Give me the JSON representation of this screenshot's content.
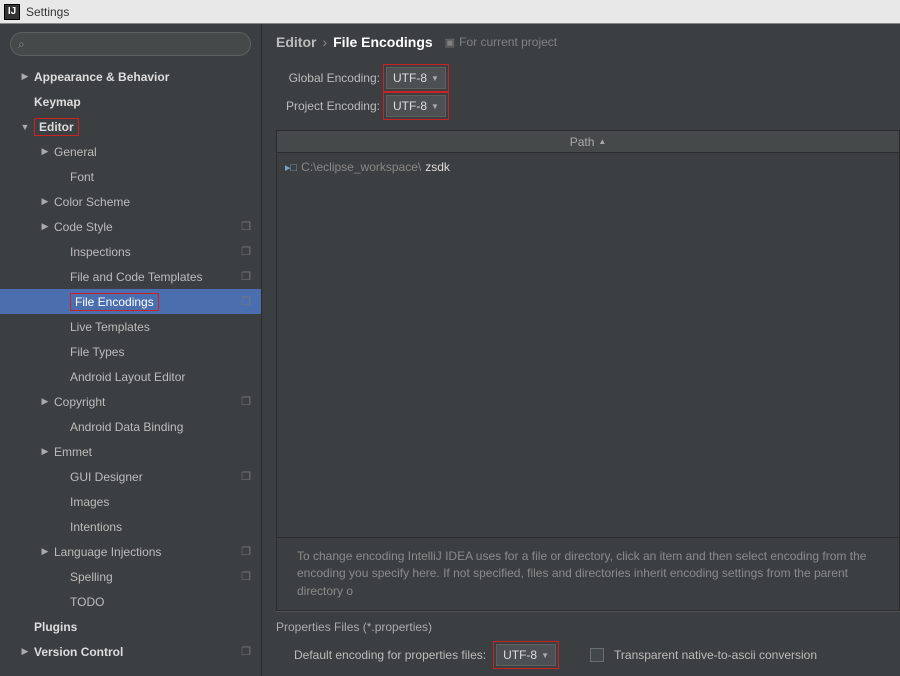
{
  "window": {
    "title": "Settings"
  },
  "search": {
    "placeholder": ""
  },
  "tree": [
    {
      "label": "Appearance & Behavior",
      "depth": 0,
      "arrow": "▶",
      "bold": true
    },
    {
      "label": "Keymap",
      "depth": 0,
      "arrow": "",
      "bold": true
    },
    {
      "label": "Editor",
      "depth": 0,
      "arrow": "▼",
      "bold": true,
      "red": true
    },
    {
      "label": "General",
      "depth": 1,
      "arrow": "▶"
    },
    {
      "label": "Font",
      "depth": 2,
      "arrow": ""
    },
    {
      "label": "Color Scheme",
      "depth": 1,
      "arrow": "▶"
    },
    {
      "label": "Code Style",
      "depth": 1,
      "arrow": "▶",
      "badge": true
    },
    {
      "label": "Inspections",
      "depth": 2,
      "arrow": "",
      "badge": true
    },
    {
      "label": "File and Code Templates",
      "depth": 2,
      "arrow": "",
      "badge": true
    },
    {
      "label": "File Encodings",
      "depth": 2,
      "arrow": "",
      "badge": true,
      "selected": true,
      "red": true
    },
    {
      "label": "Live Templates",
      "depth": 2,
      "arrow": ""
    },
    {
      "label": "File Types",
      "depth": 2,
      "arrow": ""
    },
    {
      "label": "Android Layout Editor",
      "depth": 2,
      "arrow": ""
    },
    {
      "label": "Copyright",
      "depth": 1,
      "arrow": "▶",
      "badge": true
    },
    {
      "label": "Android Data Binding",
      "depth": 2,
      "arrow": ""
    },
    {
      "label": "Emmet",
      "depth": 1,
      "arrow": "▶"
    },
    {
      "label": "GUI Designer",
      "depth": 2,
      "arrow": "",
      "badge": true
    },
    {
      "label": "Images",
      "depth": 2,
      "arrow": ""
    },
    {
      "label": "Intentions",
      "depth": 2,
      "arrow": ""
    },
    {
      "label": "Language Injections",
      "depth": 1,
      "arrow": "▶",
      "badge": true
    },
    {
      "label": "Spelling",
      "depth": 2,
      "arrow": "",
      "badge": true
    },
    {
      "label": "TODO",
      "depth": 2,
      "arrow": ""
    },
    {
      "label": "Plugins",
      "depth": 0,
      "arrow": "",
      "bold": true
    },
    {
      "label": "Version Control",
      "depth": 0,
      "arrow": "▶",
      "bold": true,
      "badge": true
    }
  ],
  "breadcrumb": {
    "root": "Editor",
    "sep": "›",
    "leaf": "File Encodings",
    "project_hint": "For current project"
  },
  "encodings": {
    "global_label": "Global Encoding:",
    "global_value": "UTF-8",
    "project_label": "Project Encoding:",
    "project_value": "UTF-8"
  },
  "table": {
    "header": "Path",
    "rows": [
      {
        "prefix": "C:\\eclipse_workspace\\",
        "name": "zsdk"
      }
    ]
  },
  "hint_text": "To change encoding IntelliJ IDEA uses for a file or directory, click an item and then select encoding from the encoding you specify here. If not specified, files and directories inherit encoding settings from the parent directory o",
  "properties": {
    "section_title": "Properties Files (*.properties)",
    "default_label": "Default encoding for properties files:",
    "default_value": "UTF-8",
    "checkbox_label": "Transparent native-to-ascii conversion"
  },
  "badge_glyph": "❐"
}
